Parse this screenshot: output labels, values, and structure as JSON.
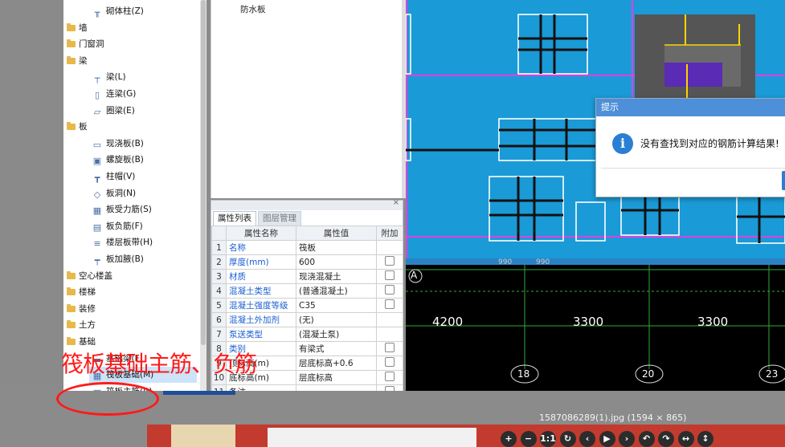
{
  "tree": {
    "items": [
      {
        "label": "砌体柱(Z)",
        "kind": "leaf",
        "icon": "column-icon"
      },
      {
        "label": "墙",
        "kind": "folder"
      },
      {
        "label": "门窗洞",
        "kind": "folder"
      },
      {
        "label": "梁",
        "kind": "folder"
      },
      {
        "label": "梁(L)",
        "kind": "leaf",
        "icon": "beam-icon"
      },
      {
        "label": "连梁(G)",
        "kind": "leaf",
        "icon": "link-beam-icon"
      },
      {
        "label": "圈梁(E)",
        "kind": "leaf",
        "icon": "ring-beam-icon"
      },
      {
        "label": "板",
        "kind": "folder"
      },
      {
        "label": "现浇板(B)",
        "kind": "leaf",
        "icon": "slab-icon"
      },
      {
        "label": "螺旋板(B)",
        "kind": "leaf",
        "icon": "spiral-slab-icon"
      },
      {
        "label": "柱帽(V)",
        "kind": "leaf",
        "icon": "column-cap-icon"
      },
      {
        "label": "板洞(N)",
        "kind": "leaf",
        "icon": "slab-hole-icon"
      },
      {
        "label": "板受力筋(S)",
        "kind": "leaf",
        "icon": "slab-rebar-icon"
      },
      {
        "label": "板负筋(F)",
        "kind": "leaf",
        "icon": "negative-rebar-icon"
      },
      {
        "label": "楼层板带(H)",
        "kind": "leaf",
        "icon": "slab-strip-icon"
      },
      {
        "label": "板加腋(B)",
        "kind": "leaf",
        "icon": "haunch-icon"
      },
      {
        "label": "空心楼盖",
        "kind": "folder"
      },
      {
        "label": "楼梯",
        "kind": "folder"
      },
      {
        "label": "装修",
        "kind": "folder"
      },
      {
        "label": "土方",
        "kind": "folder"
      },
      {
        "label": "基础",
        "kind": "folder"
      },
      {
        "label": "基础梁(F)",
        "kind": "leaf",
        "icon": "foundation-beam-icon"
      },
      {
        "label": "筏板基础(M)",
        "kind": "leaf",
        "icon": "raft-icon",
        "selected": true
      },
      {
        "label": "筏板主筋(R)",
        "kind": "leaf",
        "icon": "raft-rebar-icon"
      }
    ]
  },
  "midtop": {
    "label": "防水板"
  },
  "props": {
    "tabs": [
      "属性列表",
      "图层管理"
    ],
    "headers": [
      "属性名称",
      "属性值",
      "附加"
    ],
    "rows": [
      {
        "n": "1",
        "name": "名称",
        "value": "筏板",
        "blue": true,
        "cb": false
      },
      {
        "n": "2",
        "name": "厚度(mm)",
        "value": "600",
        "blue": true,
        "cb": true
      },
      {
        "n": "3",
        "name": "材质",
        "value": "现浇混凝土",
        "blue": true,
        "cb": true
      },
      {
        "n": "4",
        "name": "混凝土类型",
        "value": "(普通混凝土)",
        "blue": true,
        "cb": true
      },
      {
        "n": "5",
        "name": "混凝土强度等级",
        "value": "C35",
        "blue": true,
        "cb": true
      },
      {
        "n": "6",
        "name": "混凝土外加剂",
        "value": "(无)",
        "blue": true,
        "cb": false
      },
      {
        "n": "7",
        "name": "泵送类型",
        "value": "(混凝土泵)",
        "blue": true,
        "cb": false
      },
      {
        "n": "8",
        "name": "类别",
        "value": "有梁式",
        "blue": true,
        "cb": true
      },
      {
        "n": "9",
        "name": "顶标高(m)",
        "value": "层底标高+0.6",
        "blue": false,
        "cb": true
      },
      {
        "n": "10",
        "name": "底标高(m)",
        "value": "层底标高",
        "blue": false,
        "cb": true
      },
      {
        "n": "11",
        "name": "备注",
        "value": "",
        "blue": false,
        "cb": true
      }
    ]
  },
  "dialog": {
    "title": "提示",
    "message": "没有查找到对应的钢筋计算结果!",
    "icon": "info-icon"
  },
  "cad": {
    "axis_label": "A",
    "dims": [
      "4200",
      "3300",
      "3300"
    ],
    "small_dims": [
      "990",
      "990"
    ],
    "axis_nums": [
      "18",
      "20",
      "23"
    ]
  },
  "viewer": {
    "filename": "1587086289(1).jpg (1594 × 865)",
    "buttons": [
      {
        "label": "+",
        "name": "zoom-in-icon"
      },
      {
        "label": "−",
        "name": "zoom-out-icon"
      },
      {
        "label": "1:1",
        "name": "actual-size-icon"
      },
      {
        "label": "↻",
        "name": "refresh-icon"
      },
      {
        "label": "‹",
        "name": "prev-icon"
      },
      {
        "label": "▶",
        "name": "play-icon"
      },
      {
        "label": "›",
        "name": "next-icon"
      },
      {
        "label": "↶",
        "name": "rotate-left-icon"
      },
      {
        "label": "↷",
        "name": "rotate-right-icon"
      },
      {
        "label": "↔",
        "name": "flip-horizontal-icon"
      },
      {
        "label": "↕",
        "name": "flip-vertical-icon"
      }
    ]
  },
  "annotation": {
    "text": "筏板基础主筋、负筋"
  },
  "colors": {
    "cad_bg": "#1a9ad6",
    "annotation": "#ff1a1a",
    "dialog_title": "#4d8fd8"
  }
}
